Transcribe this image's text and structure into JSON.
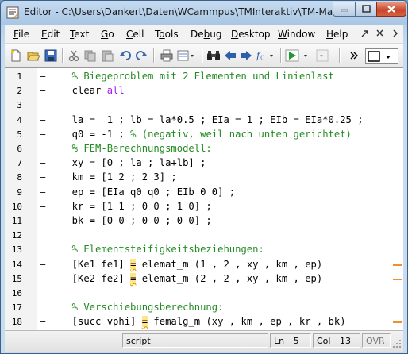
{
  "window": {
    "title": "Editor - C:\\Users\\Dankert\\Daten\\WCammpus\\TMInteraktiv\\TM-Math...",
    "buttons": {
      "minimize": "minimize",
      "maximize": "maximize",
      "close": "close"
    }
  },
  "menubar": {
    "items": [
      "File",
      "Edit",
      "Text",
      "Go",
      "Cell",
      "Tools",
      "Debug",
      "Desktop",
      "Window",
      "Help"
    ],
    "underline": [
      "F",
      "E",
      "T",
      "G",
      "C",
      "o",
      "b",
      "D",
      "W",
      "H"
    ]
  },
  "toolbar": {
    "icons": [
      "new-file-icon",
      "open-folder-icon",
      "save-icon",
      "cut-icon",
      "copy-icon",
      "paste-icon",
      "undo-icon",
      "redo-icon",
      "print-icon",
      "print-preview-icon",
      "find-icon",
      "back-icon",
      "forward-icon",
      "function-icon",
      "run-icon",
      "run-dropdown-icon",
      "stop-dropdown-icon",
      "layout-icon"
    ]
  },
  "editor": {
    "lines": [
      {
        "n": "1",
        "dash": "–",
        "segments": [
          {
            "t": "  % Biegeproblem mit 2 Elementen und Linienlast",
            "c": "cm"
          }
        ]
      },
      {
        "n": "2",
        "dash": "–",
        "segments": [
          {
            "t": "  clear ",
            "c": ""
          },
          {
            "t": "all",
            "c": "kw"
          }
        ]
      },
      {
        "n": "3",
        "dash": "",
        "segments": []
      },
      {
        "n": "4",
        "dash": "–",
        "segments": [
          {
            "t": "  la =  1 ; lb = la*0.5 ; EIa = 1 ; EIb = EIa*0.25 ;",
            "c": ""
          }
        ]
      },
      {
        "n": "5",
        "dash": "–",
        "segments": [
          {
            "t": "  q0 = -1 ; ",
            "c": ""
          },
          {
            "t": "% (negativ, weil nach unten gerichtet)",
            "c": "cm"
          }
        ]
      },
      {
        "n": "6",
        "dash": "",
        "segments": [
          {
            "t": "  % FEM-Berechnungsmodell:",
            "c": "cm"
          }
        ]
      },
      {
        "n": "7",
        "dash": "–",
        "segments": [
          {
            "t": "  xy = [0 ; la ; la+lb] ;",
            "c": ""
          }
        ]
      },
      {
        "n": "8",
        "dash": "–",
        "segments": [
          {
            "t": "  km = [1 2 ; 2 3] ;",
            "c": ""
          }
        ]
      },
      {
        "n": "9",
        "dash": "–",
        "segments": [
          {
            "t": "  ep = [EIa q0 q0 ; EIb 0 0] ;",
            "c": ""
          }
        ]
      },
      {
        "n": "10",
        "dash": "–",
        "segments": [
          {
            "t": "  kr = [1 1 ; 0 0 ; 1 0] ;",
            "c": ""
          }
        ]
      },
      {
        "n": "11",
        "dash": "–",
        "segments": [
          {
            "t": "  bk = [0 0 ; 0 0 ; 0 0] ;",
            "c": ""
          }
        ]
      },
      {
        "n": "12",
        "dash": "",
        "segments": []
      },
      {
        "n": "13",
        "dash": "",
        "segments": [
          {
            "t": "  % Elementsteifigkeitsbeziehungen:",
            "c": "cm"
          }
        ]
      },
      {
        "n": "14",
        "dash": "–",
        "segments": [
          {
            "t": "  [Ke1 fe1] ",
            "c": ""
          },
          {
            "t": "=",
            "c": "hl"
          },
          {
            "t": " elemat_m (1 , 2 , xy , km , ep)",
            "c": ""
          }
        ]
      },
      {
        "n": "15",
        "dash": "–",
        "segments": [
          {
            "t": "  [Ke2 fe2] ",
            "c": ""
          },
          {
            "t": "=",
            "c": "hl"
          },
          {
            "t": " elemat_m (2 , 2 , xy , km , ep)",
            "c": ""
          }
        ]
      },
      {
        "n": "16",
        "dash": "",
        "segments": []
      },
      {
        "n": "17",
        "dash": "",
        "segments": [
          {
            "t": "  % Verschiebungsberechnung:",
            "c": "cm"
          }
        ]
      },
      {
        "n": "18",
        "dash": "–",
        "segments": [
          {
            "t": "  [succ vphi] ",
            "c": ""
          },
          {
            "t": "=",
            "c": "hl"
          },
          {
            "t": " femalg_m (xy , km , ep , kr , bk)",
            "c": ""
          }
        ]
      }
    ],
    "marker_lines": [
      14,
      15,
      18
    ]
  },
  "statusbar": {
    "mode": "script",
    "ln_label": "Ln",
    "ln_value": "5",
    "col_label": "Col",
    "col_value": "13",
    "ovr": "OVR"
  }
}
